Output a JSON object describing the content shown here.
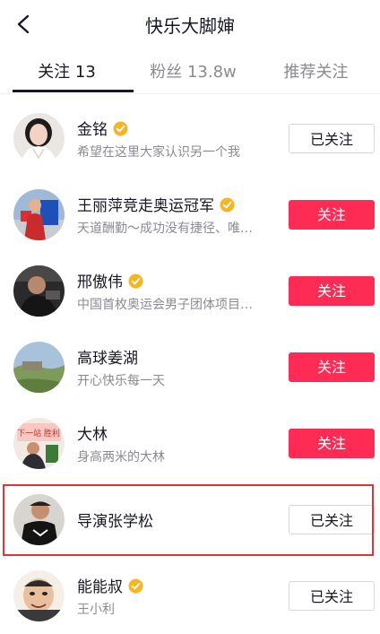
{
  "header": {
    "title": "快乐大脚婶"
  },
  "tabs": [
    {
      "label": "关注 13"
    },
    {
      "label": "粉丝 13.8w"
    },
    {
      "label": "推荐关注"
    }
  ],
  "users": [
    {
      "name": "金铭",
      "verified": true,
      "desc": "希望在这里大家认识另一个我",
      "button": "已关注"
    },
    {
      "name": "王丽萍竞走奥运冠军",
      "verified": true,
      "desc": "天道酬勤～成功没有捷径、唯…",
      "button": "关注"
    },
    {
      "name": "邢傲伟",
      "verified": true,
      "desc": "中国首枚奥运会男子团体项目…",
      "button": "关注"
    },
    {
      "name": "高球姜湖",
      "verified": false,
      "desc": "开心快乐每一天",
      "button": "关注"
    },
    {
      "name": "大林",
      "verified": false,
      "desc": "身高两米的大林",
      "button": "关注"
    },
    {
      "name": "导演张学松",
      "verified": false,
      "desc": "",
      "button": "已关注"
    },
    {
      "name": "能能叔",
      "verified": true,
      "desc": "王小利",
      "button": "已关注"
    }
  ],
  "colors": {
    "follow_button": "#fe2c55",
    "verified_badge": "#f5b524",
    "highlight_box": "#e0343a"
  },
  "avatar_sign_text": "下一站 胜利"
}
